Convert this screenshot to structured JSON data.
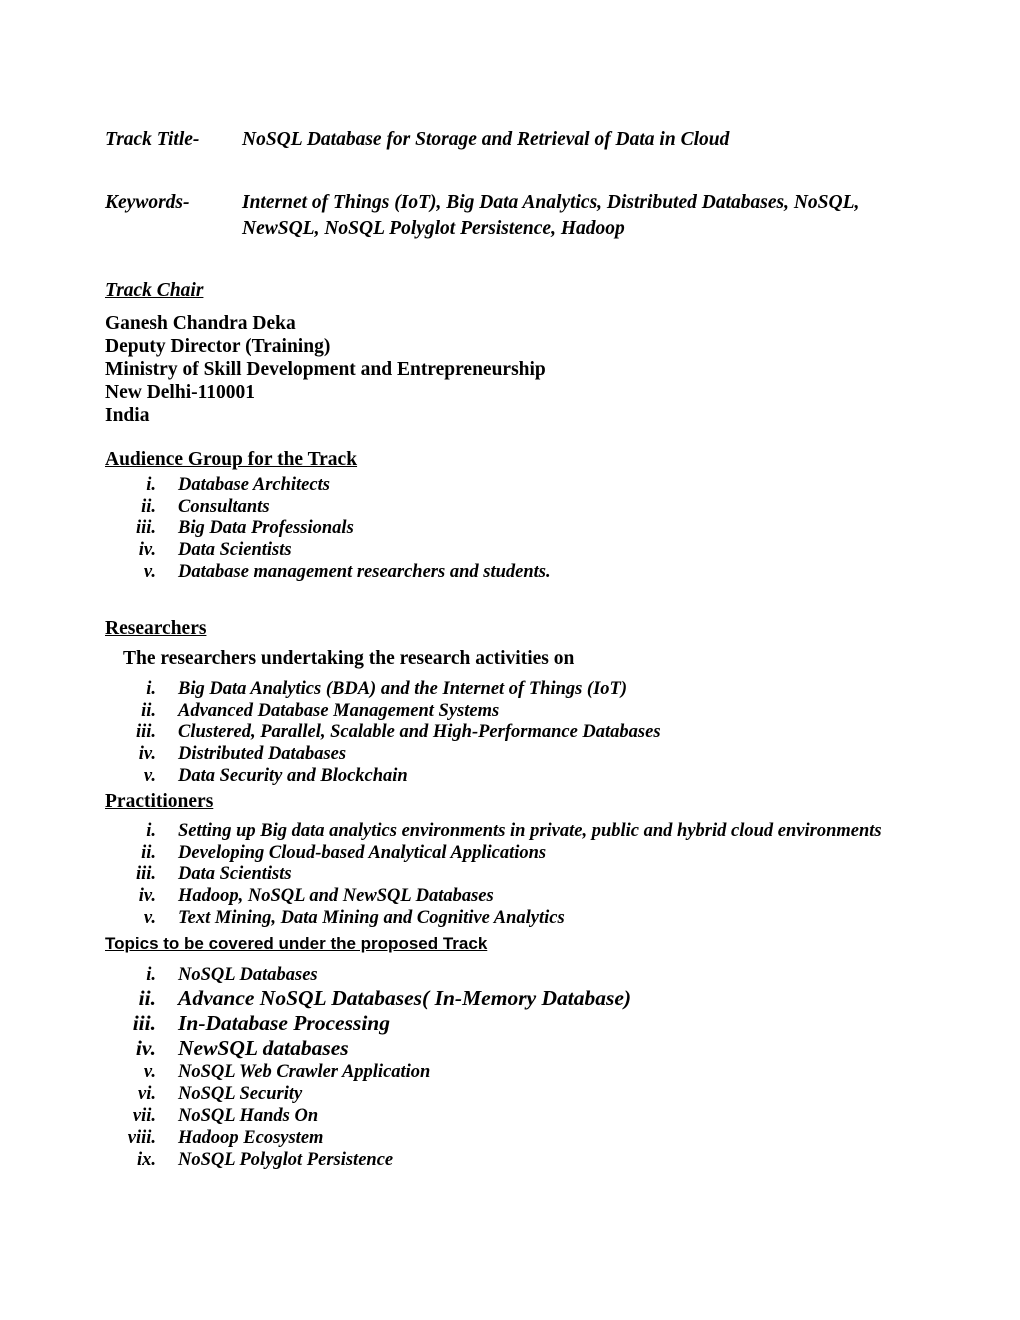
{
  "document": {
    "track_title": {
      "label": "Track Title-",
      "value": "NoSQL Database for Storage and Retrieval of Data in Cloud"
    },
    "keywords": {
      "label": "Keywords-",
      "value": "Internet of Things (IoT), Big Data Analytics, Distributed Databases, NoSQL, NewSQL, NoSQL Polyglot Persistence, Hadoop"
    },
    "track_chair": {
      "heading": "Track Chair",
      "name": "Ganesh Chandra Deka",
      "designation": "Deputy Director (Training)",
      "organisation": "Ministry of Skill Development and Entrepreneurship",
      "city": "New Delhi-110001",
      "country": "India"
    },
    "audience_group": {
      "heading": "Audience Group for the Track",
      "items": [
        {
          "num": "i.",
          "text": "Database Architects"
        },
        {
          "num": "ii.",
          "text": "Consultants"
        },
        {
          "num": "iii.",
          "text": "Big Data Professionals"
        },
        {
          "num": "iv.",
          "text": "Data Scientists"
        },
        {
          "num": "v.",
          "text": "Database management researchers and students."
        }
      ]
    },
    "researchers": {
      "heading": "Researchers",
      "intro": "The researchers undertaking the research activities on",
      "items": [
        {
          "num": "i.",
          "text": "Big Data Analytics (BDA) and the Internet of Things (IoT)"
        },
        {
          "num": "ii.",
          "text": "Advanced Database Management Systems"
        },
        {
          "num": "iii.",
          "text": "Clustered, Parallel, Scalable and High-Performance Databases"
        },
        {
          "num": "iv.",
          "text": "Distributed Databases"
        },
        {
          "num": "v.",
          "text": "Data Security and Blockchain"
        }
      ]
    },
    "practitioners": {
      "heading": "Practitioners",
      "items": [
        {
          "num": "i.",
          "text": "Setting up Big data analytics environments in private, public and hybrid cloud environments"
        },
        {
          "num": "ii.",
          "text": "Developing Cloud-based Analytical Applications"
        },
        {
          "num": "iii.",
          "text": "Data Scientists"
        },
        {
          "num": "iv.",
          "text": "Hadoop, NoSQL and NewSQL Databases"
        },
        {
          "num": "v.",
          "text": "Text Mining, Data Mining and Cognitive Analytics"
        }
      ]
    },
    "topics": {
      "heading": "Topics to be covered under the proposed Track",
      "items": [
        {
          "num": "i.",
          "text": "NoSQL Databases",
          "emphasis": false
        },
        {
          "num": "ii.",
          "text": "Advance NoSQL Databases( In-Memory Database)",
          "emphasis": true
        },
        {
          "num": "iii.",
          "text": "In-Database Processing",
          "emphasis": true
        },
        {
          "num": "iv.",
          "text": "NewSQL databases",
          "emphasis": true
        },
        {
          "num": "v.",
          "text": "NoSQL Web Crawler Application",
          "emphasis": false
        },
        {
          "num": "vi.",
          "text": "NoSQL Security",
          "emphasis": false
        },
        {
          "num": "vii.",
          "text": "NoSQL Hands On",
          "emphasis": false
        },
        {
          "num": "viii.",
          "text": "Hadoop Ecosystem",
          "emphasis": false
        },
        {
          "num": "ix.",
          "text": "NoSQL Polyglot Persistence",
          "emphasis": false
        }
      ]
    }
  }
}
